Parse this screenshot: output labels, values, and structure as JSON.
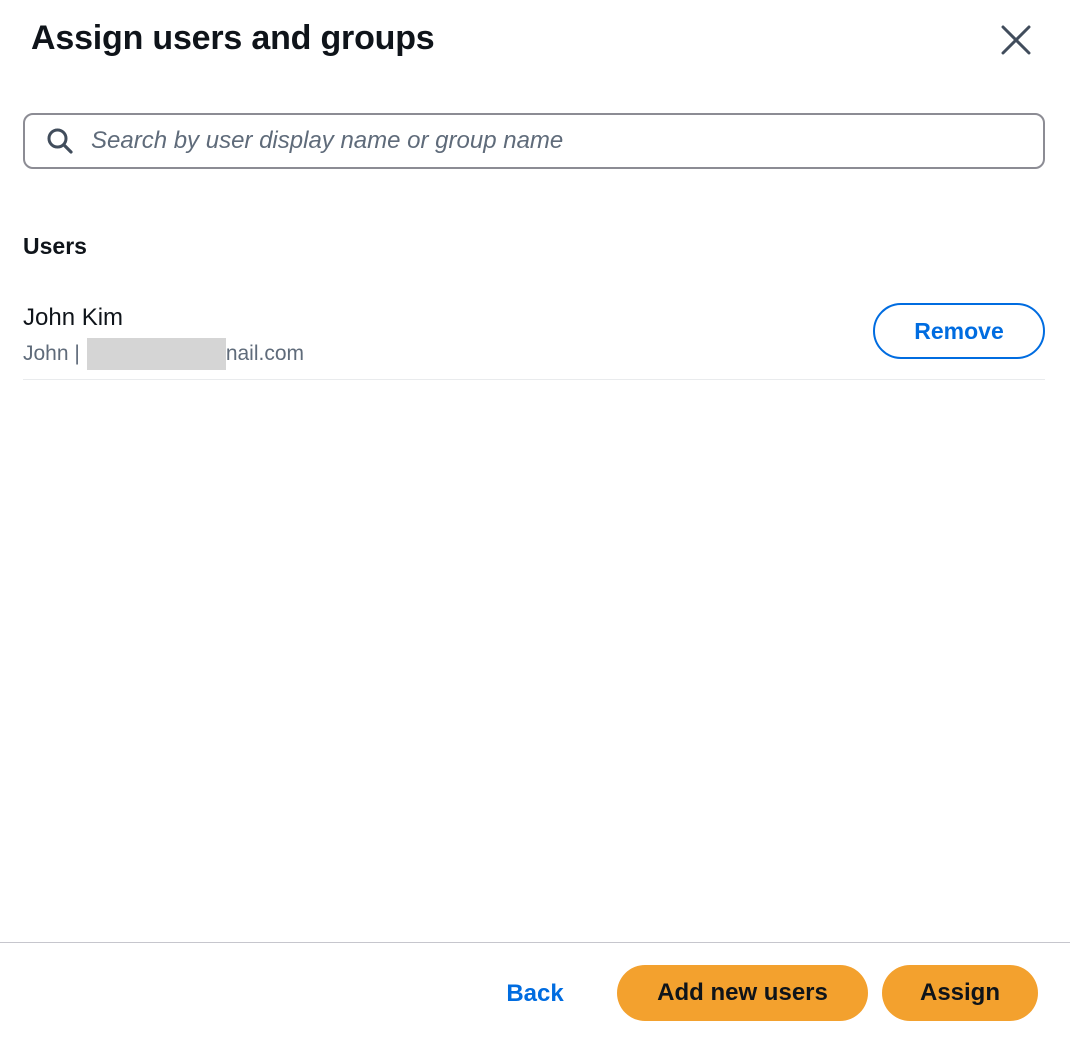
{
  "modal": {
    "title": "Assign users and groups",
    "close_icon": "close-icon"
  },
  "search": {
    "icon": "search-icon",
    "placeholder": "Search by user display name or group name",
    "value": ""
  },
  "users_section": {
    "heading": "Users",
    "users": [
      {
        "name": "John Kim",
        "detail_prefix": "John |",
        "detail_suffix": "nail.com",
        "remove_label": "Remove"
      }
    ]
  },
  "footer": {
    "back_label": "Back",
    "add_new_users_label": "Add new users",
    "assign_label": "Assign"
  },
  "colors": {
    "primary_button": "#f3a12e",
    "link": "#006ce0",
    "text": "#0f141a",
    "muted_text": "#5f6b7a",
    "redaction": "#d5d5d5"
  }
}
